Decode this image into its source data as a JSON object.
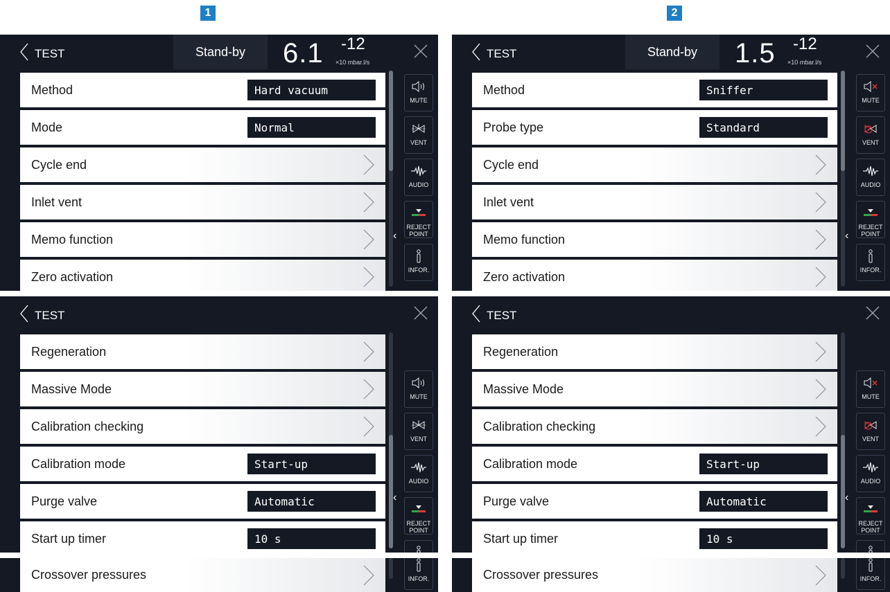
{
  "labels": [
    "1",
    "2"
  ],
  "header": {
    "back": "TEST",
    "status": "Stand-by",
    "exponent": "-12",
    "unit": "×10 mbar.l/s"
  },
  "readings": [
    "6.1",
    "1.5"
  ],
  "side": {
    "mute": "MUTE",
    "vent": "VENT",
    "audio": "AUDIO",
    "reject": "REJECT POINT",
    "infor": "INFOR."
  },
  "left_top": [
    {
      "label": "Method",
      "value": "Hard vacuum"
    },
    {
      "label": "Mode",
      "value": "Normal"
    },
    {
      "label": "Cycle end"
    },
    {
      "label": "Inlet vent"
    },
    {
      "label": "Memo function"
    },
    {
      "label": "Zero activation"
    }
  ],
  "right_top": [
    {
      "label": "Method",
      "value": "Sniffer"
    },
    {
      "label": "Probe type",
      "value": "Standard"
    },
    {
      "label": "Cycle end"
    },
    {
      "label": "Inlet vent"
    },
    {
      "label": "Memo function"
    },
    {
      "label": "Zero activation"
    }
  ],
  "bottom": [
    {
      "label": "Regeneration"
    },
    {
      "label": "Massive Mode"
    },
    {
      "label": "Calibration checking"
    },
    {
      "label": "Calibration mode",
      "value": "Start-up"
    },
    {
      "label": "Purge valve",
      "value": "Automatic"
    },
    {
      "label": "Start up timer",
      "value": "10 s"
    }
  ],
  "strip": {
    "label": "Crossover pressures"
  },
  "colors": {
    "panel_bg": "#141923",
    "label_badge": "#1f7fc6",
    "row_bg": "#ffffff",
    "value_bg": "#141923"
  },
  "icons": [
    "chevron-left-icon",
    "close-icon",
    "chevron-right-icon",
    "speaker-icon",
    "speaker-muted-icon",
    "vent-valve-icon",
    "vent-disabled-icon",
    "waveform-icon",
    "reject-point-icon",
    "info-icon"
  ]
}
